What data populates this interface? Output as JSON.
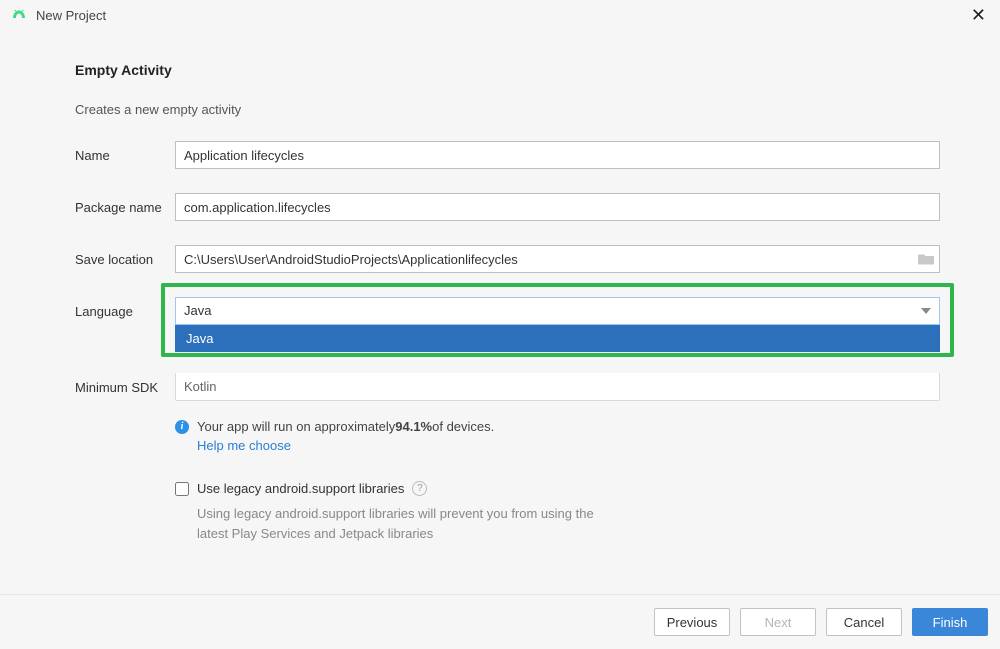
{
  "window": {
    "title": "New Project"
  },
  "page": {
    "heading": "Empty Activity",
    "subtitle": "Creates a new empty activity"
  },
  "labels": {
    "name": "Name",
    "package": "Package name",
    "save": "Save location",
    "language": "Language",
    "minsdk": "Minimum SDK"
  },
  "fields": {
    "name_value": "Application lifecycles",
    "package_value": "com.application.lifecycles",
    "save_value": "C:\\Users\\User\\AndroidStudioProjects\\Applicationlifecycles",
    "language_value": "Java",
    "minsdk_value": "Kotlin"
  },
  "dropdown": {
    "option1": "Java"
  },
  "info": {
    "prefix": "Your app will run on approximately ",
    "percent": "94.1%",
    "suffix": " of devices.",
    "help": "Help me choose"
  },
  "legacy": {
    "label": "Use legacy android.support libraries",
    "note": "Using legacy android.support libraries will prevent you from using the latest Play Services and Jetpack libraries"
  },
  "footer": {
    "previous": "Previous",
    "next": "Next",
    "cancel": "Cancel",
    "finish": "Finish"
  }
}
